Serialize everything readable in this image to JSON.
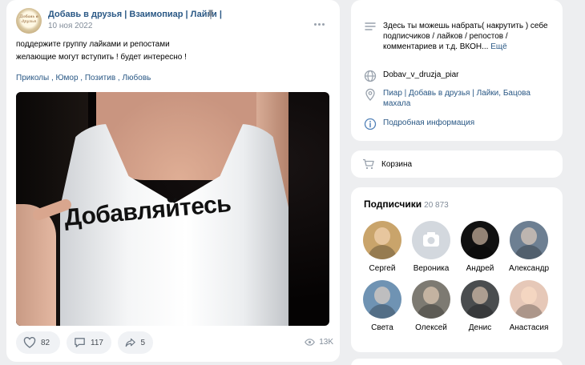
{
  "post": {
    "avatar_text": "Добавь в друзья",
    "title": "Добавь в друзья | Взаимопиар | Лайки |",
    "date": "10 ноя 2022",
    "text_line1": "поддержите группу лайками и репостами",
    "text_line2": "желающие могут вступить ! будет интересно !",
    "tags": "Приколы , Юмор , Позитив , Любовь",
    "photo_text": "Добавляйтесь",
    "likes": "82",
    "comments": "117",
    "shares": "5",
    "views": "13K"
  },
  "info": {
    "description": "Здесь ты можешь набрать( накрутить ) себе подписчиков / лайков / репостов / комментариев и т.д.",
    "description_tail": "ВКОН...",
    "more_link": "Ещё",
    "site": "Dobav_v_druzja_piar",
    "address": "Пиар | Добавь в друзья | Лайки, Бацова махала",
    "details": "Подробная информация"
  },
  "cart": {
    "label": "Корзина"
  },
  "subscribers": {
    "title": "Подписчики",
    "count": "20 873",
    "people": [
      {
        "name": "Сергей",
        "color": "#c9a46b"
      },
      {
        "name": "Вероника",
        "color": "#d3d8de"
      },
      {
        "name": "Андрей",
        "color": "#111111"
      },
      {
        "name": "Александр",
        "color": "#6d7f92"
      },
      {
        "name": "Света",
        "color": "#6f93b3"
      },
      {
        "name": "Олексей",
        "color": "#7d7a72"
      },
      {
        "name": "Денис",
        "color": "#4a4d4f"
      },
      {
        "name": "Анастасия",
        "color": "#e6c8b8"
      }
    ]
  },
  "colors": {
    "link": "#2a5885",
    "muted": "#818c99",
    "background": "#edeef0"
  }
}
